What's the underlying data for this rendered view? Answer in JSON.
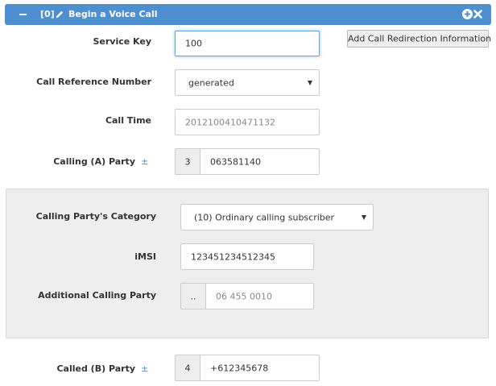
{
  "header": {
    "collapse_icon": "minus-icon",
    "index": "[0]",
    "title": "Begin a Voice Call",
    "edit_icon": "pencil-icon",
    "actions": [
      "plus-circle-icon",
      "close-icon"
    ]
  },
  "fields": {
    "service_key": {
      "label": "Service Key",
      "value": "100"
    },
    "call_reference": {
      "label": "Call Reference Number",
      "value": "generated"
    },
    "call_time": {
      "label": "Call Time",
      "placeholder": "2012100410471132"
    },
    "calling_party": {
      "label": "Calling (A) Party",
      "toggle": "±",
      "prefix": "3",
      "value": "063581140"
    }
  },
  "redirection_button": {
    "label": "Add Call Redirection Information"
  },
  "calling_panel": {
    "category": {
      "label": "Calling Party's Category",
      "value": "(10) Ordinary calling subscriber"
    },
    "imsi": {
      "label": "iMSI",
      "value": "123451234512345"
    },
    "additional_calling_party": {
      "label": "Additional Calling Party",
      "prefix": "..",
      "placeholder": "06 455 0010"
    }
  },
  "called_party": {
    "label": "Called (B) Party",
    "toggle": "±",
    "prefix": "4",
    "value": "+612345678"
  },
  "colors": {
    "accent": "#4d8fd1",
    "panel": "#eeeeee",
    "border": "#cccccc"
  }
}
